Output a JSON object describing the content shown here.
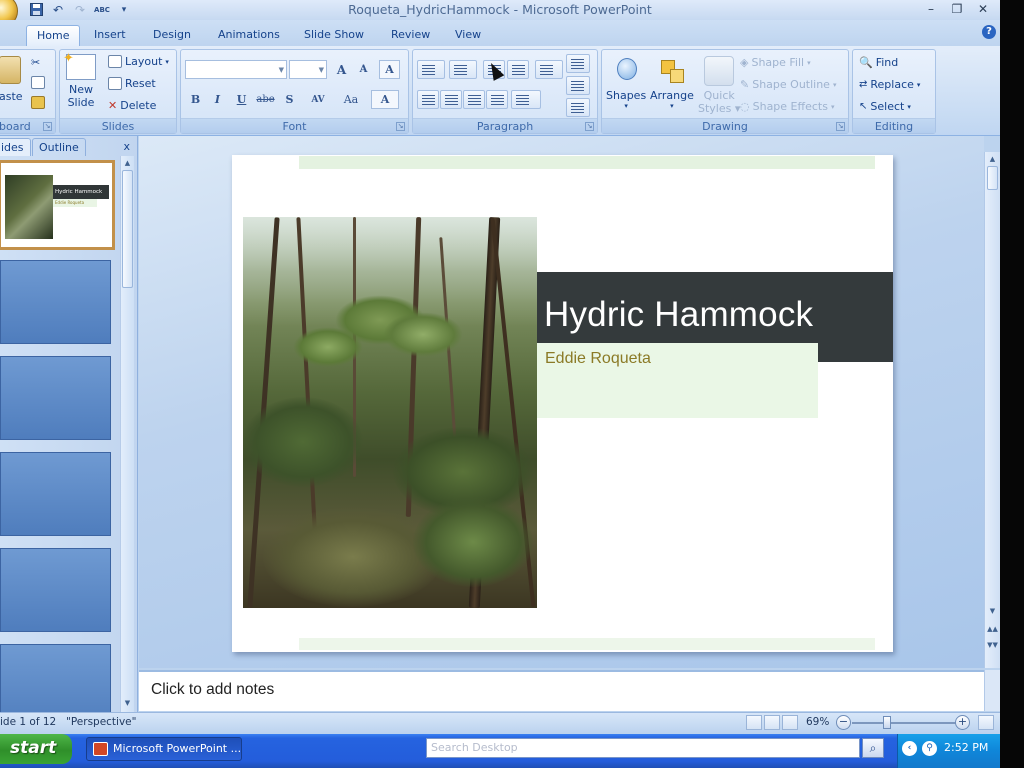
{
  "window": {
    "title": "Roqueta_HydricHammock - Microsoft PowerPoint",
    "minimize": "–",
    "restore": "❐",
    "close": "✕"
  },
  "quick_access": {
    "save": "💾",
    "undo": "↶",
    "redo": "↷",
    "spelling": "ABC",
    "customize": "▾"
  },
  "tabs": [
    {
      "label": "Home",
      "active": true
    },
    {
      "label": "Insert"
    },
    {
      "label": "Design"
    },
    {
      "label": "Animations"
    },
    {
      "label": "Slide Show"
    },
    {
      "label": "Review"
    },
    {
      "label": "View"
    }
  ],
  "help_label": "?",
  "ribbon": {
    "clipboard": {
      "paste": "aste",
      "label": "board"
    },
    "slides": {
      "new_slide_line1": "New",
      "new_slide_line2": "Slide",
      "layout": "Layout",
      "reset": "Reset",
      "delete": "Delete",
      "label": "Slides"
    },
    "font": {
      "font_name_value": "",
      "font_size_value": "",
      "grow": "A",
      "shrink": "A",
      "clear": "A",
      "bold": "B",
      "italic": "I",
      "underline": "U",
      "strike": "abe",
      "shadow": "S",
      "spacing": "AV",
      "case": "Aa",
      "color": "A",
      "label": "Font"
    },
    "paragraph": {
      "label": "Paragraph"
    },
    "drawing": {
      "shapes": "Shapes",
      "arrange": "Arrange",
      "quick_styles_line1": "Quick",
      "quick_styles_line2": "Styles",
      "shape_fill": "Shape Fill",
      "shape_outline": "Shape Outline",
      "shape_effects": "Shape Effects",
      "label": "Drawing"
    },
    "editing": {
      "find": "Find",
      "replace": "Replace",
      "select": "Select",
      "label": "Editing"
    }
  },
  "left_pane": {
    "tab_slides": "ides",
    "tab_outline": "Outline",
    "close": "x",
    "thumb1_title": "Hydric Hammock",
    "thumb1_subtitle": "Eddie Roqueta"
  },
  "slide": {
    "title": "Hydric Hammock",
    "subtitle": "Eddie Roqueta"
  },
  "notes": {
    "placeholder": "Click to add notes"
  },
  "status": {
    "slide_counter": "ide 1 of 12",
    "theme": "\"Perspective\"",
    "zoom": "69%",
    "zoom_out": "−",
    "zoom_in": "+"
  },
  "taskbar": {
    "start": "start",
    "task_button": "Microsoft PowerPoint ...",
    "search_placeholder": "Search Desktop",
    "time": "2:52 PM"
  },
  "colors": {
    "title_bar": "#343a3c",
    "subtitle_text": "#8b7a26",
    "ribbon_text": "#15428b"
  }
}
